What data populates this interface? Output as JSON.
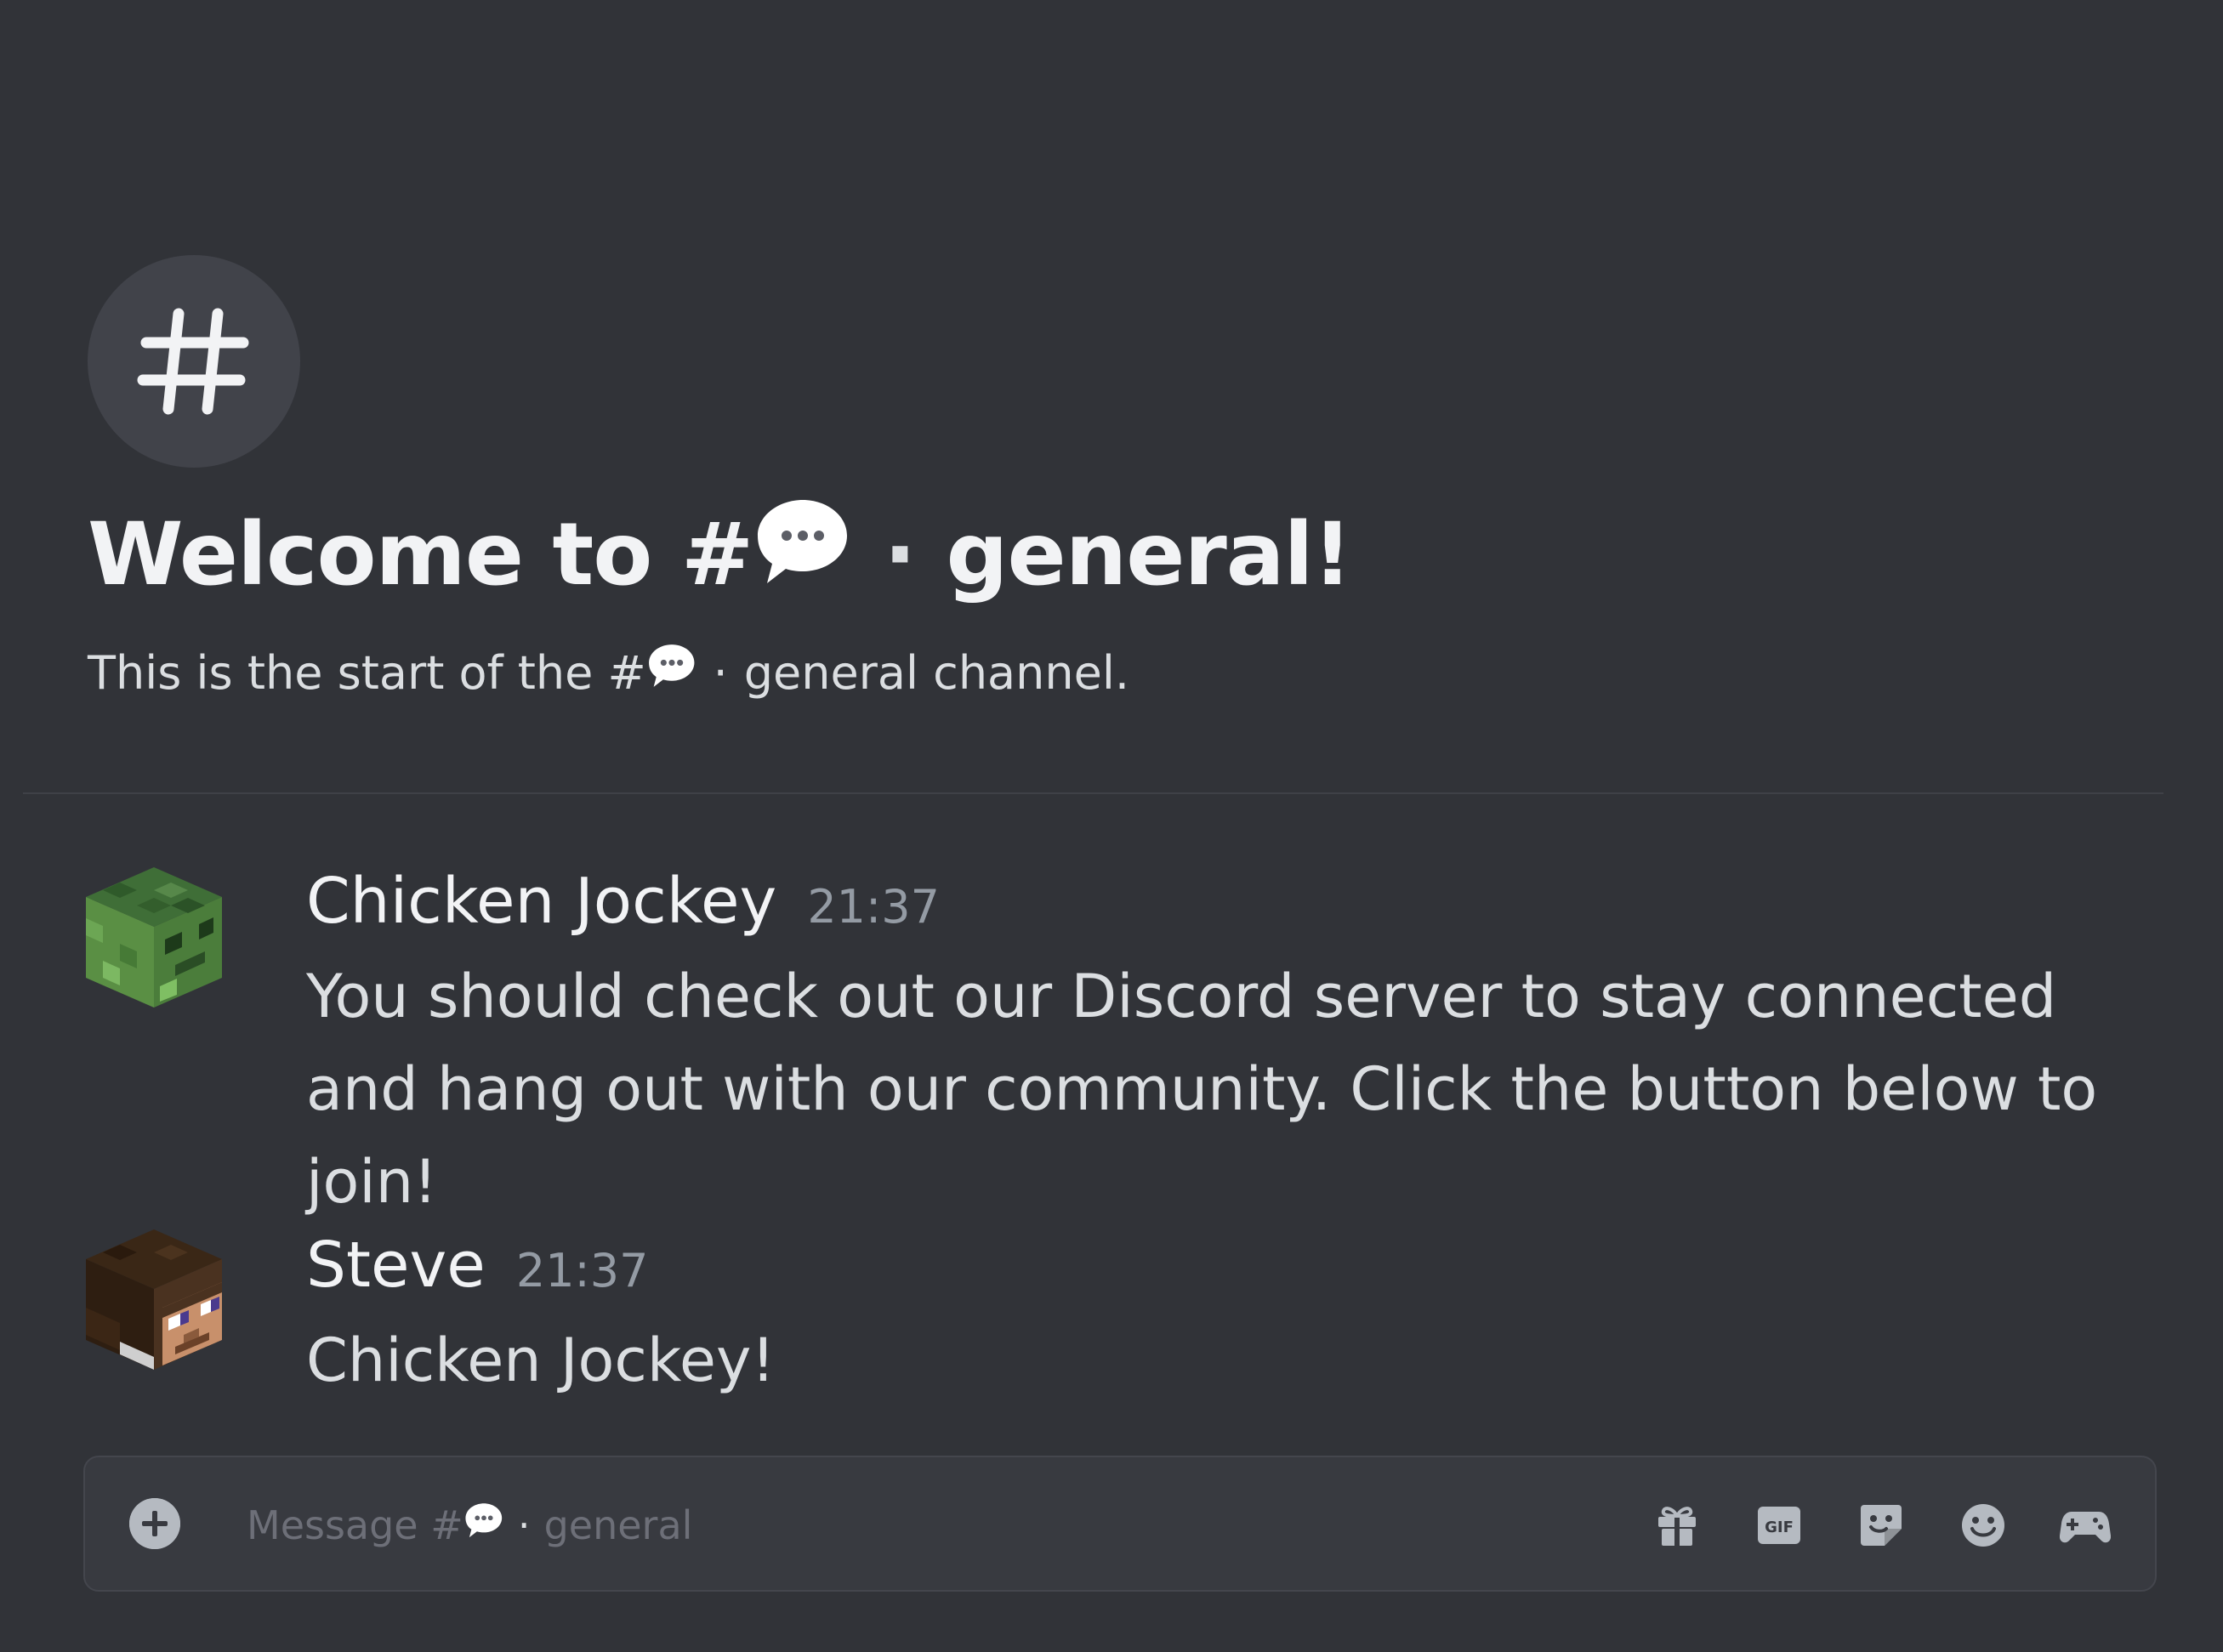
{
  "channel": {
    "hash": "#",
    "name": "general",
    "separator": "·"
  },
  "welcome": {
    "title_prefix": "Welcome to #",
    "title_suffix": "general!",
    "subtitle_prefix": "This is the start of the #",
    "subtitle_suffix": "general channel."
  },
  "messages": [
    {
      "username": "Chicken Jockey",
      "timestamp": "21:37",
      "content": "You should check out our Discord server to stay connected and hang out with our community. Click the button below to join!",
      "avatar_icon": "zombie-head-avatar"
    },
    {
      "username": "Steve",
      "timestamp": "21:37",
      "content": "Chicken Jockey!",
      "avatar_icon": "steve-head-avatar"
    }
  ],
  "composer": {
    "placeholder_prefix": "Message #",
    "placeholder_suffix": "general",
    "actions": [
      "gift-icon",
      "gif-icon",
      "sticker-icon",
      "emoji-icon",
      "activity-icon"
    ],
    "gif_label": "GIF"
  },
  "colors": {
    "background": "#313338",
    "hero_circle": "#41434a",
    "composer_bg": "#383a40",
    "username": "#f2f3f5",
    "timestamp": "#949ba4",
    "icon": "#b5bac1"
  }
}
